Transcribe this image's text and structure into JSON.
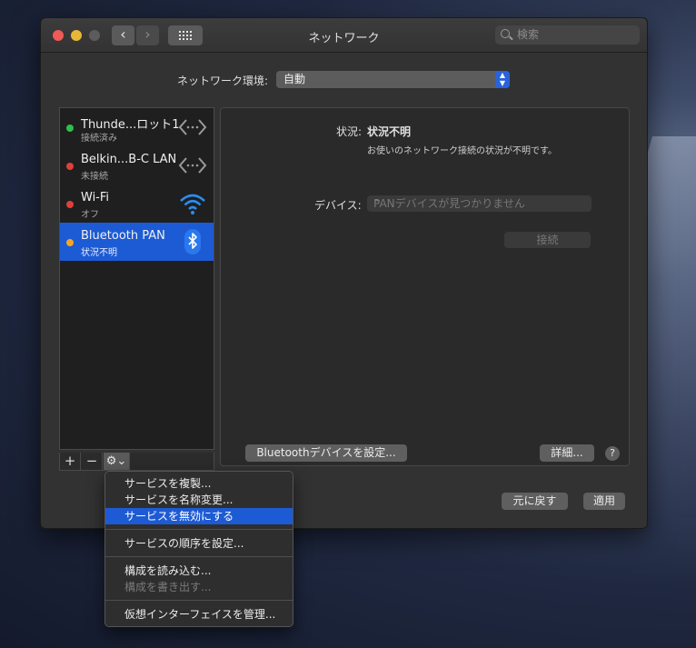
{
  "window": {
    "title": "ネットワーク"
  },
  "search": {
    "placeholder": "検索"
  },
  "env": {
    "label": "ネットワーク環境:",
    "value": "自動"
  },
  "services": [
    {
      "name": "Thunde...ロット1",
      "status": "接続済み",
      "status_color": "#2fbf4a",
      "icon": "ethernet-arrows-icon"
    },
    {
      "name": "Belkin...B-C LAN",
      "status": "未接続",
      "status_color": "#e0403a",
      "icon": "ethernet-arrows-icon"
    },
    {
      "name": "Wi-Fi",
      "status": "オフ",
      "status_color": "#e0403a",
      "icon": "wifi-icon"
    },
    {
      "name": "Bluetooth PAN",
      "status": "状況不明",
      "status_color": "#f4a623",
      "icon": "bluetooth-icon"
    }
  ],
  "toolbar": {
    "add": "+",
    "remove": "−",
    "gear": "⚙⌄"
  },
  "detail": {
    "status_label": "状況:",
    "status_value": "状況不明",
    "status_desc": "お使いのネットワーク接続の状況が不明です。",
    "device_label": "デバイス:",
    "device_value": "PANデバイスが見つかりません",
    "connect": "接続",
    "bt_setup": "Bluetoothデバイスを設定...",
    "advanced": "詳細...",
    "help": "?"
  },
  "footer": {
    "revert": "元に戻す",
    "apply": "適用"
  },
  "menu": {
    "items": [
      "サービスを複製...",
      "サービスを名称変更...",
      "サービスを無効にする",
      "サービスの順序を設定...",
      "構成を読み込む...",
      "構成を書き出す...",
      "仮想インターフェイスを管理..."
    ]
  },
  "colors": {
    "accent": "#1d5bd4",
    "window_bg": "#323232"
  }
}
